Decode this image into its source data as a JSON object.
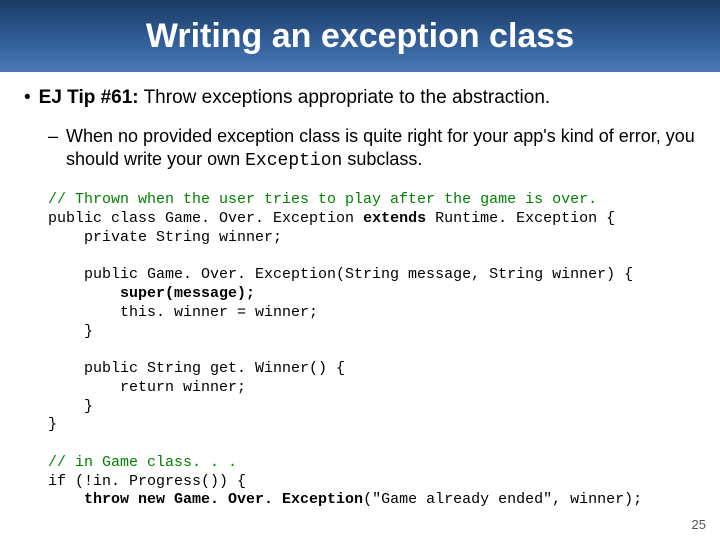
{
  "title": "Writing an exception class",
  "bullet1": {
    "tip_label": "EJ Tip #61:",
    "tip_text": " Throw exceptions appropriate to the abstraction."
  },
  "bullet2": {
    "text_before": "When no provided exception class is quite right for your app's kind of error, you should write your own ",
    "mono": "Exception",
    "text_after": " subclass."
  },
  "code": {
    "comment1": "// Thrown when the user tries to play after the game is over.",
    "l2a": "public class Game. Over. Exception ",
    "l2b": "extends",
    "l2c": " Runtime. Exception {",
    "l3": "    private String winner;",
    "l5": "    public Game. Over. Exception(String message, String winner) {",
    "l6": "        super(message);",
    "l7": "        this. winner = winner;",
    "l8": "    }",
    "l10": "    public String get. Winner() {",
    "l11": "        return winner;",
    "l12": "    }",
    "l13": "}",
    "comment2": "// in Game class. . .",
    "l15": "if (!in. Progress()) {",
    "l16a": "    throw new Game. Over. Exception",
    "l16b": "(\"Game already ended\", winner);"
  },
  "page_number": "25"
}
